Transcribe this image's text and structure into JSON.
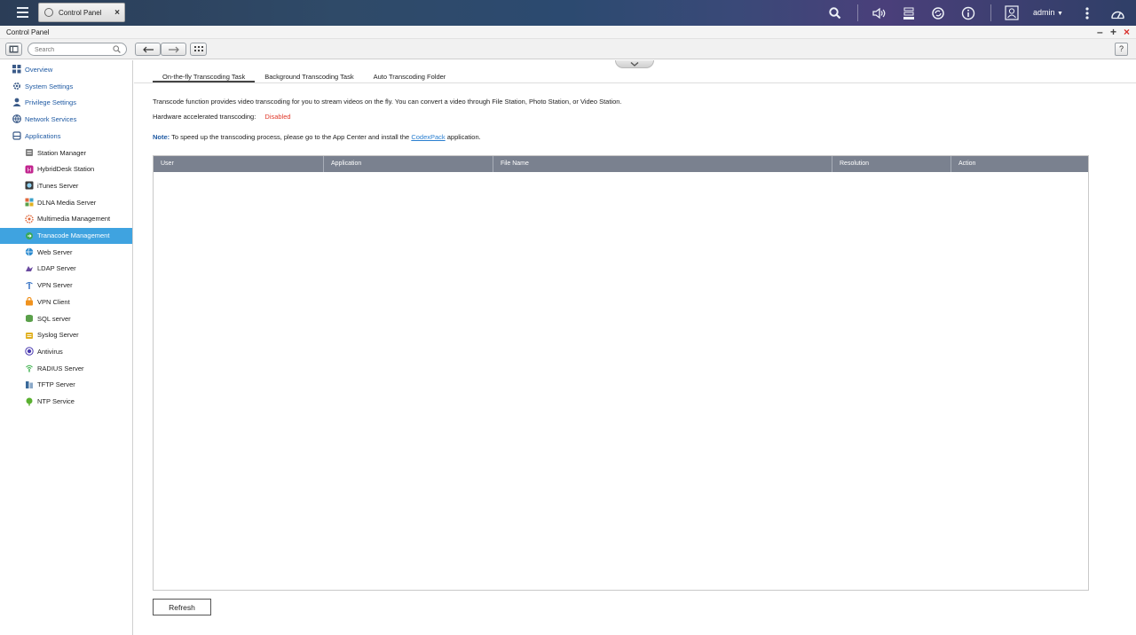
{
  "taskbar": {
    "tab_label": "Control Panel",
    "user": "admin"
  },
  "window": {
    "title": "Control Panel"
  },
  "toolbar": {
    "search_placeholder": "Search",
    "help": "?"
  },
  "sidebar": {
    "items": [
      {
        "label": "Overview",
        "icon": "overview-icon"
      },
      {
        "label": "System Settings",
        "icon": "gear-icon"
      },
      {
        "label": "Privilege Settings",
        "icon": "user-icon"
      },
      {
        "label": "Network Services",
        "icon": "globe-icon"
      },
      {
        "label": "Applications",
        "icon": "applications-icon"
      }
    ],
    "apps": [
      {
        "label": "Station Manager",
        "icon": "station-manager-icon",
        "color": "#7d7d7d"
      },
      {
        "label": "HybridDesk Station",
        "icon": "hybriddesk-icon",
        "color": "#c2258f"
      },
      {
        "label": "iTunes Server",
        "icon": "itunes-icon",
        "color": "#3a3a3a"
      },
      {
        "label": "DLNA Media Server",
        "icon": "dlna-icon",
        "color": "#3aa0c8"
      },
      {
        "label": "Multimedia Management",
        "icon": "multimedia-icon",
        "color": "#e0673a"
      },
      {
        "label": "Tranacode Management",
        "icon": "transcode-icon",
        "color": "#3aa85a"
      },
      {
        "label": "Web Server",
        "icon": "web-server-icon",
        "color": "#2a8ad0"
      },
      {
        "label": "LDAP Server",
        "icon": "ldap-icon",
        "color": "#6a4aa0"
      },
      {
        "label": "VPN Server",
        "icon": "vpn-server-icon",
        "color": "#2a6ac0"
      },
      {
        "label": "VPN Client",
        "icon": "vpn-client-icon",
        "color": "#f0921e"
      },
      {
        "label": "SQL server",
        "icon": "sql-icon",
        "color": "#5aa04a"
      },
      {
        "label": "Syslog Server",
        "icon": "syslog-icon",
        "color": "#e0b020"
      },
      {
        "label": "Antivirus",
        "icon": "antivirus-icon",
        "color": "#4a3ab0"
      },
      {
        "label": "RADIUS Server",
        "icon": "radius-icon",
        "color": "#3ab04a"
      },
      {
        "label": "TFTP Server",
        "icon": "tftp-icon",
        "color": "#3a6a9a"
      },
      {
        "label": "NTP Service",
        "icon": "ntp-icon",
        "color": "#5ab030"
      }
    ],
    "active_app": "Tranacode Management"
  },
  "main": {
    "tabs": [
      "On-the-fly Transcoding Task",
      "Background Transcoding Task",
      "Auto Transcoding Folder"
    ],
    "description": "Transcode function provides video transcoding for you to stream videos on the fly. You can convert a video through File Station, Photo Station, or Video Station.",
    "hw_label": "Hardware accelerated transcoding:",
    "hw_status": "Disabled",
    "note_label": "Note:",
    "note_text": " To speed up the transcoding process, please go to the App Center and install the ",
    "note_link": "CodexPack",
    "note_suffix": " application.",
    "table_columns": [
      "User",
      "Application",
      "File Name",
      "Resolution",
      "Action"
    ],
    "refresh_label": "Refresh"
  },
  "colors": {
    "accent": "#3fa3e0",
    "link": "#1f5aa3",
    "disabled": "#e0392b",
    "header": "#7a818f"
  }
}
